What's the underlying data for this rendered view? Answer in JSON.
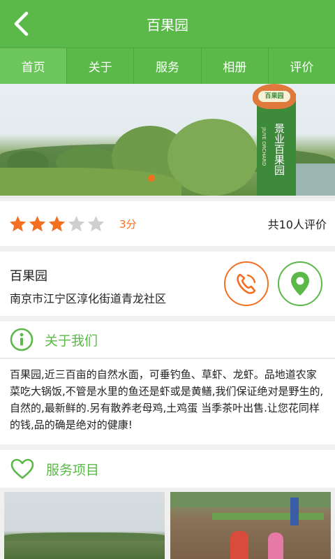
{
  "header": {
    "title": "百果园",
    "back_icon": "chevron-left-icon"
  },
  "tabs": [
    {
      "label": "首页",
      "active": true
    },
    {
      "label": "关于",
      "active": false
    },
    {
      "label": "服务",
      "active": false
    },
    {
      "label": "相册",
      "active": false
    },
    {
      "label": "评价",
      "active": false
    }
  ],
  "banner": {
    "sign_logo_text": "百果园",
    "sign_text": "景业百果园",
    "sign_en_text": "JIUYE ORCHARD",
    "active_slide": 1
  },
  "rating": {
    "stars_filled": 3,
    "stars_total": 5,
    "score_label": "3分",
    "reviews_label": "共10人评价"
  },
  "info": {
    "name": "百果园",
    "address": "南京市江宁区淳化街道青龙社区"
  },
  "about": {
    "heading": "关于我们",
    "text": "百果园,近三百亩的自然水面，可垂钓鱼、草虾、龙虾。品地道农家菜吃大锅饭,不管是水里的鱼还是虾或是黄鳝,我们保证绝对是野生的,自然的,最新鲜的.另有散养老母鸡,土鸡蛋 当季茶叶出售.让您花同样的钱,品的确是绝对的健康!"
  },
  "services": {
    "heading": "服务项目"
  },
  "colors": {
    "primary": "#5bb94a",
    "accent": "#f36f21",
    "star_empty": "#cfcfcf"
  }
}
